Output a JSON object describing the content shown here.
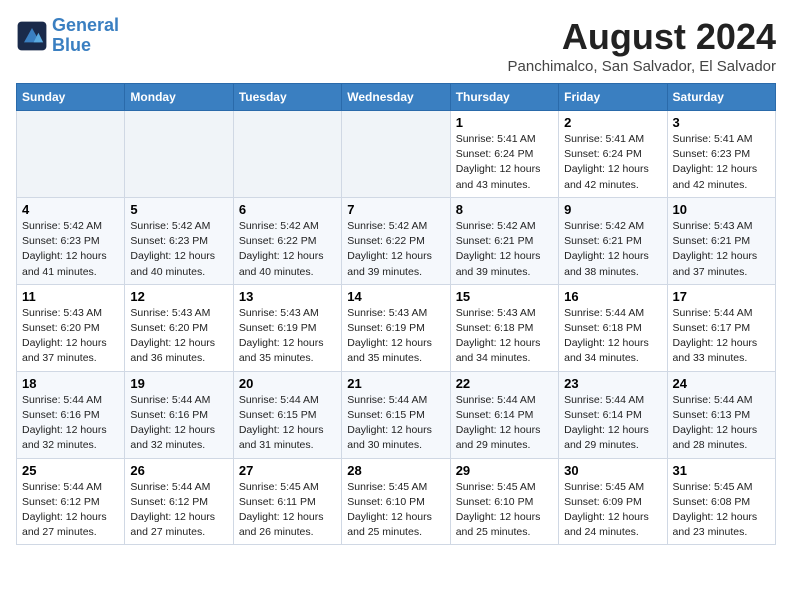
{
  "header": {
    "logo_line1": "General",
    "logo_line2": "Blue",
    "month_year": "August 2024",
    "location": "Panchimalco, San Salvador, El Salvador"
  },
  "weekdays": [
    "Sunday",
    "Monday",
    "Tuesday",
    "Wednesday",
    "Thursday",
    "Friday",
    "Saturday"
  ],
  "weeks": [
    [
      {
        "day": "",
        "empty": true
      },
      {
        "day": "",
        "empty": true
      },
      {
        "day": "",
        "empty": true
      },
      {
        "day": "",
        "empty": true
      },
      {
        "day": "1",
        "line1": "Sunrise: 5:41 AM",
        "line2": "Sunset: 6:24 PM",
        "line3": "Daylight: 12 hours",
        "line4": "and 43 minutes."
      },
      {
        "day": "2",
        "line1": "Sunrise: 5:41 AM",
        "line2": "Sunset: 6:24 PM",
        "line3": "Daylight: 12 hours",
        "line4": "and 42 minutes."
      },
      {
        "day": "3",
        "line1": "Sunrise: 5:41 AM",
        "line2": "Sunset: 6:23 PM",
        "line3": "Daylight: 12 hours",
        "line4": "and 42 minutes."
      }
    ],
    [
      {
        "day": "4",
        "line1": "Sunrise: 5:42 AM",
        "line2": "Sunset: 6:23 PM",
        "line3": "Daylight: 12 hours",
        "line4": "and 41 minutes."
      },
      {
        "day": "5",
        "line1": "Sunrise: 5:42 AM",
        "line2": "Sunset: 6:23 PM",
        "line3": "Daylight: 12 hours",
        "line4": "and 40 minutes."
      },
      {
        "day": "6",
        "line1": "Sunrise: 5:42 AM",
        "line2": "Sunset: 6:22 PM",
        "line3": "Daylight: 12 hours",
        "line4": "and 40 minutes."
      },
      {
        "day": "7",
        "line1": "Sunrise: 5:42 AM",
        "line2": "Sunset: 6:22 PM",
        "line3": "Daylight: 12 hours",
        "line4": "and 39 minutes."
      },
      {
        "day": "8",
        "line1": "Sunrise: 5:42 AM",
        "line2": "Sunset: 6:21 PM",
        "line3": "Daylight: 12 hours",
        "line4": "and 39 minutes."
      },
      {
        "day": "9",
        "line1": "Sunrise: 5:42 AM",
        "line2": "Sunset: 6:21 PM",
        "line3": "Daylight: 12 hours",
        "line4": "and 38 minutes."
      },
      {
        "day": "10",
        "line1": "Sunrise: 5:43 AM",
        "line2": "Sunset: 6:21 PM",
        "line3": "Daylight: 12 hours",
        "line4": "and 37 minutes."
      }
    ],
    [
      {
        "day": "11",
        "line1": "Sunrise: 5:43 AM",
        "line2": "Sunset: 6:20 PM",
        "line3": "Daylight: 12 hours",
        "line4": "and 37 minutes."
      },
      {
        "day": "12",
        "line1": "Sunrise: 5:43 AM",
        "line2": "Sunset: 6:20 PM",
        "line3": "Daylight: 12 hours",
        "line4": "and 36 minutes."
      },
      {
        "day": "13",
        "line1": "Sunrise: 5:43 AM",
        "line2": "Sunset: 6:19 PM",
        "line3": "Daylight: 12 hours",
        "line4": "and 35 minutes."
      },
      {
        "day": "14",
        "line1": "Sunrise: 5:43 AM",
        "line2": "Sunset: 6:19 PM",
        "line3": "Daylight: 12 hours",
        "line4": "and 35 minutes."
      },
      {
        "day": "15",
        "line1": "Sunrise: 5:43 AM",
        "line2": "Sunset: 6:18 PM",
        "line3": "Daylight: 12 hours",
        "line4": "and 34 minutes."
      },
      {
        "day": "16",
        "line1": "Sunrise: 5:44 AM",
        "line2": "Sunset: 6:18 PM",
        "line3": "Daylight: 12 hours",
        "line4": "and 34 minutes."
      },
      {
        "day": "17",
        "line1": "Sunrise: 5:44 AM",
        "line2": "Sunset: 6:17 PM",
        "line3": "Daylight: 12 hours",
        "line4": "and 33 minutes."
      }
    ],
    [
      {
        "day": "18",
        "line1": "Sunrise: 5:44 AM",
        "line2": "Sunset: 6:16 PM",
        "line3": "Daylight: 12 hours",
        "line4": "and 32 minutes."
      },
      {
        "day": "19",
        "line1": "Sunrise: 5:44 AM",
        "line2": "Sunset: 6:16 PM",
        "line3": "Daylight: 12 hours",
        "line4": "and 32 minutes."
      },
      {
        "day": "20",
        "line1": "Sunrise: 5:44 AM",
        "line2": "Sunset: 6:15 PM",
        "line3": "Daylight: 12 hours",
        "line4": "and 31 minutes."
      },
      {
        "day": "21",
        "line1": "Sunrise: 5:44 AM",
        "line2": "Sunset: 6:15 PM",
        "line3": "Daylight: 12 hours",
        "line4": "and 30 minutes."
      },
      {
        "day": "22",
        "line1": "Sunrise: 5:44 AM",
        "line2": "Sunset: 6:14 PM",
        "line3": "Daylight: 12 hours",
        "line4": "and 29 minutes."
      },
      {
        "day": "23",
        "line1": "Sunrise: 5:44 AM",
        "line2": "Sunset: 6:14 PM",
        "line3": "Daylight: 12 hours",
        "line4": "and 29 minutes."
      },
      {
        "day": "24",
        "line1": "Sunrise: 5:44 AM",
        "line2": "Sunset: 6:13 PM",
        "line3": "Daylight: 12 hours",
        "line4": "and 28 minutes."
      }
    ],
    [
      {
        "day": "25",
        "line1": "Sunrise: 5:44 AM",
        "line2": "Sunset: 6:12 PM",
        "line3": "Daylight: 12 hours",
        "line4": "and 27 minutes."
      },
      {
        "day": "26",
        "line1": "Sunrise: 5:44 AM",
        "line2": "Sunset: 6:12 PM",
        "line3": "Daylight: 12 hours",
        "line4": "and 27 minutes."
      },
      {
        "day": "27",
        "line1": "Sunrise: 5:45 AM",
        "line2": "Sunset: 6:11 PM",
        "line3": "Daylight: 12 hours",
        "line4": "and 26 minutes."
      },
      {
        "day": "28",
        "line1": "Sunrise: 5:45 AM",
        "line2": "Sunset: 6:10 PM",
        "line3": "Daylight: 12 hours",
        "line4": "and 25 minutes."
      },
      {
        "day": "29",
        "line1": "Sunrise: 5:45 AM",
        "line2": "Sunset: 6:10 PM",
        "line3": "Daylight: 12 hours",
        "line4": "and 25 minutes."
      },
      {
        "day": "30",
        "line1": "Sunrise: 5:45 AM",
        "line2": "Sunset: 6:09 PM",
        "line3": "Daylight: 12 hours",
        "line4": "and 24 minutes."
      },
      {
        "day": "31",
        "line1": "Sunrise: 5:45 AM",
        "line2": "Sunset: 6:08 PM",
        "line3": "Daylight: 12 hours",
        "line4": "and 23 minutes."
      }
    ]
  ]
}
